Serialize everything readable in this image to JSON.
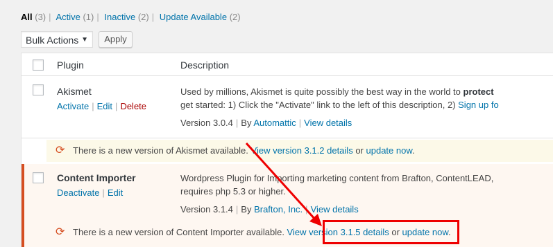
{
  "filters": [
    {
      "label": "All",
      "count": "(3)",
      "current": true
    },
    {
      "label": "Active",
      "count": "(1)",
      "current": false
    },
    {
      "label": "Inactive",
      "count": "(2)",
      "current": false
    },
    {
      "label": "Update Available",
      "count": "(2)",
      "current": false
    }
  ],
  "bulk": {
    "selected": "Bulk Actions",
    "apply": "Apply"
  },
  "table": {
    "col_plugin": "Plugin",
    "col_description": "Description"
  },
  "plugins": [
    {
      "name": "Akismet",
      "actions": [
        "Activate",
        "Edit",
        "Delete"
      ],
      "desc_pre": "Used by millions, Akismet is quite possibly the best way in the world to ",
      "desc_bold": "protect",
      "desc_line2_pre": "get started: 1) Click the \"Activate\" link to the left of this description, 2) ",
      "desc_line2_link": "Sign up fo",
      "version": "Version 3.0.4",
      "by": "By",
      "author": "Automattic",
      "details": "View details",
      "update_pre": "There is a new version of Akismet available. ",
      "update_link": "View version 3.1.2 details",
      "update_or": " or ",
      "update_now": "update now",
      "update_end": "."
    },
    {
      "name": "Content Importer",
      "actions": [
        "Deactivate",
        "Edit"
      ],
      "desc_line1": "Wordpress Plugin for Importing marketing content from Brafton, ContentLEAD,",
      "desc_line2": "requires php 5.3 or higher.",
      "version": "Version 3.1.4",
      "by": "By",
      "author": "Brafton, Inc.",
      "details": "View details",
      "update_pre": "There is a new version of Content Importer available. ",
      "update_link": "View version 3.1.5 details",
      "update_or": " or ",
      "update_now": "update now",
      "update_end": "."
    }
  ],
  "colors": {
    "link": "#0073aa",
    "delete": "#aa0000",
    "active_border": "#d54e21",
    "annotation": "#ee0000"
  }
}
